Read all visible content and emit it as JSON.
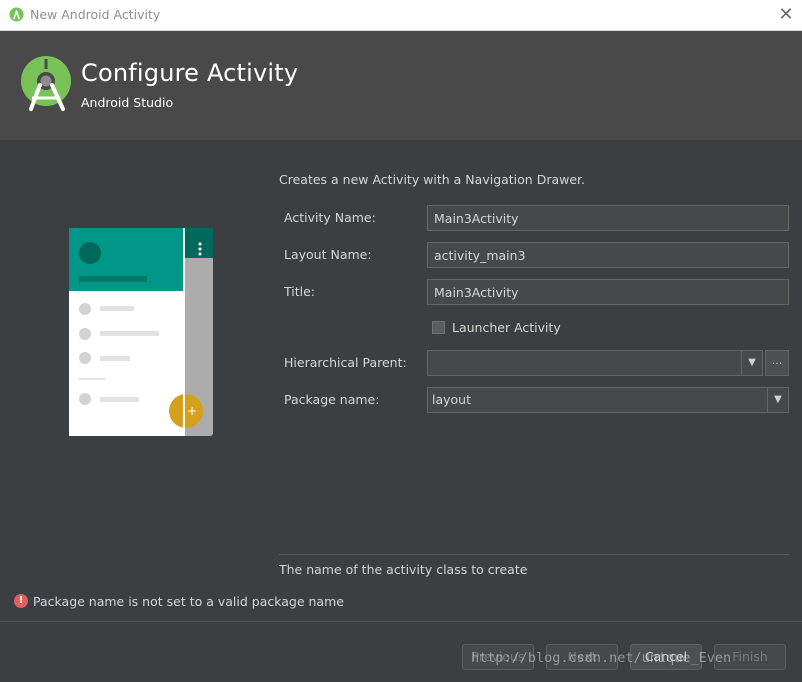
{
  "window": {
    "title": "New Android Activity"
  },
  "header": {
    "title": "Configure Activity",
    "subtitle": "Android Studio"
  },
  "form": {
    "description": "Creates a new Activity with a Navigation Drawer.",
    "activity_name": {
      "label": "Activity Name:",
      "value": "Main3Activity"
    },
    "layout_name": {
      "label": "Layout Name:",
      "value": "activity_main3"
    },
    "title": {
      "label": "Title:",
      "value": "Main3Activity"
    },
    "launcher_activity": {
      "label": "Launcher Activity",
      "checked": false
    },
    "hierarchical_parent": {
      "label": "Hierarchical Parent:",
      "value": "",
      "browse_label": "..."
    },
    "package_name": {
      "label": "Package name:",
      "value": "layout"
    }
  },
  "hint": "The name of the activity class to create",
  "error": {
    "icon": "error-icon",
    "text": "Package name is not set to a valid package name"
  },
  "buttons": {
    "previous": "Previous",
    "next": "Next",
    "cancel": "Cancel",
    "finish": "Finish"
  },
  "watermark": "http://blog.csdn.net/unique_Even",
  "colors": {
    "accent": "#009688",
    "fab": "#d6a01c",
    "logo_green": "#78c257",
    "error": "#e35f5f"
  }
}
